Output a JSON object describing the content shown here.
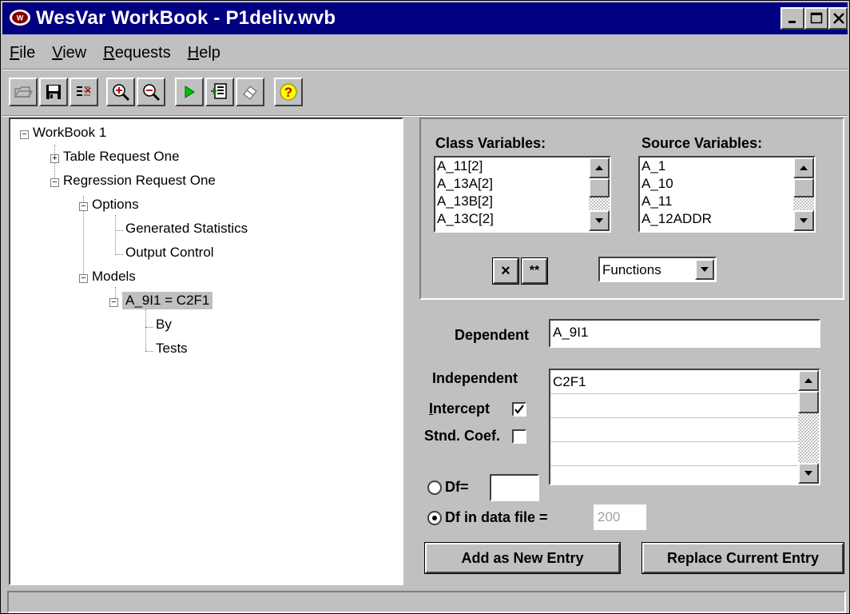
{
  "window": {
    "title": "WesVar WorkBook - P1deliv.wvb",
    "app_icon": "wesvar-icon",
    "controls": [
      "minimize-icon",
      "maximize-icon",
      "close-icon"
    ]
  },
  "menu": {
    "items": [
      {
        "label": "File",
        "accel": "F"
      },
      {
        "label": "View",
        "accel": "V"
      },
      {
        "label": "Requests",
        "accel": "R"
      },
      {
        "label": "Help",
        "accel": "H"
      }
    ]
  },
  "toolbar": {
    "buttons": [
      "open-folder-icon",
      "save-disk-icon",
      "properties-icon",
      "zoom-in-icon",
      "zoom-out-icon",
      "run-icon",
      "output-icon",
      "eraser-icon",
      "help-icon"
    ]
  },
  "tree": {
    "root": "WorkBook 1",
    "table_request": "Table Request One",
    "regression_request": "Regression Request One",
    "options": "Options",
    "generated_statistics": "Generated Statistics",
    "output_control": "Output Control",
    "models": "Models",
    "model": "A_9I1 = C2F1",
    "by": "By",
    "tests": "Tests"
  },
  "class_variables": {
    "label": "Class Variables:",
    "items": [
      "A_11[2]",
      "A_13A[2]",
      "A_13B[2]",
      "A_13C[2]"
    ]
  },
  "source_variables": {
    "label": "Source Variables:",
    "items": [
      "A_1",
      "A_10",
      "A_11",
      "A_12ADDR"
    ]
  },
  "operators": {
    "multiply": "×",
    "power": "**"
  },
  "functions": {
    "selected": "Functions"
  },
  "dependent": {
    "label": "Dependent",
    "value": "A_9I1"
  },
  "independent": {
    "label": "Independent",
    "items": [
      "C2F1",
      "",
      "",
      "",
      ""
    ]
  },
  "intercept": {
    "label": "Intercept",
    "checked": true
  },
  "stnd_coef": {
    "label": "Stnd. Coef.",
    "checked": false
  },
  "df": {
    "label": "Df=",
    "value": "",
    "selected": false
  },
  "df_data_file": {
    "label": "Df in data file =",
    "value": "200",
    "selected": true
  },
  "buttons": {
    "add": "Add as New Entry",
    "replace": "Replace Current Entry"
  },
  "status": {
    "text": ""
  }
}
